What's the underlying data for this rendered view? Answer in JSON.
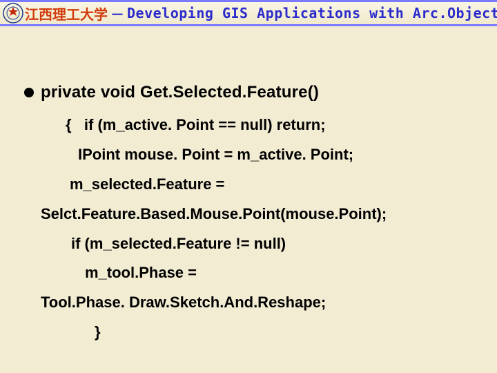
{
  "header": {
    "university": "江西理工大学",
    "separator": "－",
    "course": "Developing GIS Applications with Arc.Objects using C#. NE"
  },
  "slide": {
    "signature": "private void Get.Selected.Feature()",
    "lines": [
      "{   if (m_active. Point == null) return;",
      "IPoint mouse. Point = m_active. Point;",
      "m_selected.Feature =",
      "Selct.Feature.Based.Mouse.Point(mouse.Point);",
      "if (m_selected.Feature != null)",
      "m_tool.Phase =",
      "Tool.Phase. Draw.Sketch.And.Reshape;",
      "}"
    ]
  }
}
